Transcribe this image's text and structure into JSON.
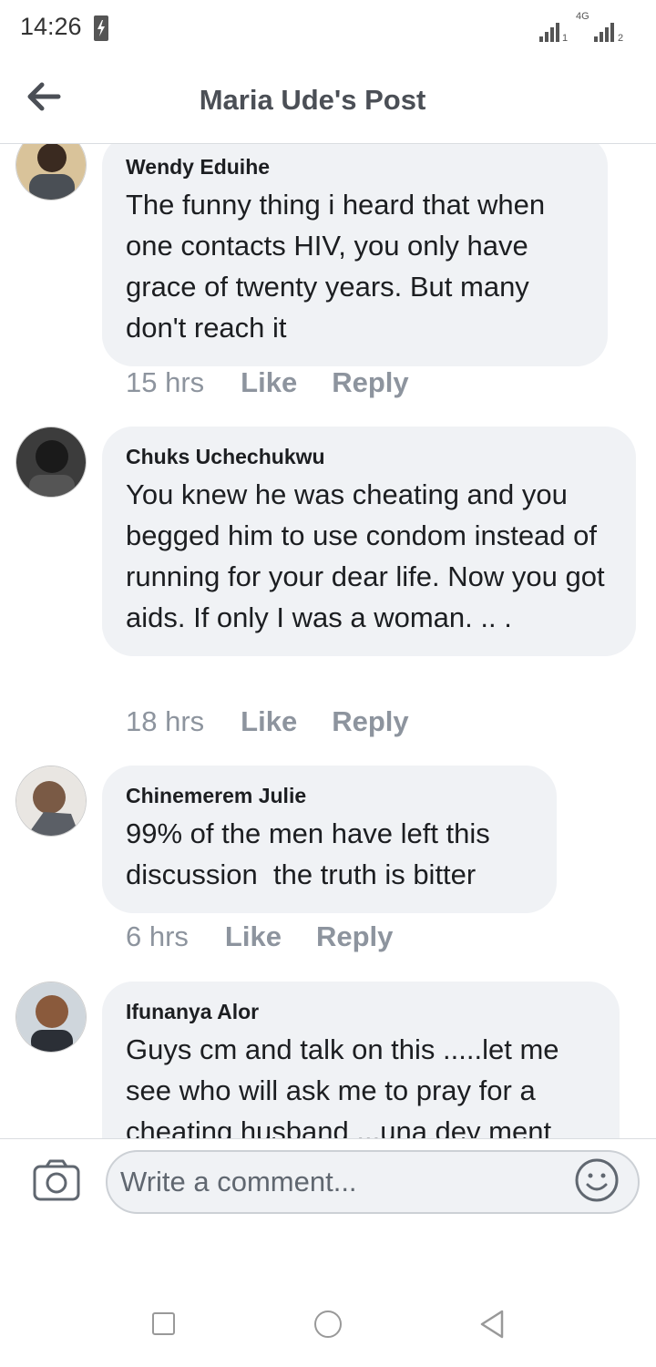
{
  "status_bar": {
    "time": "14:26",
    "network_label": "4G",
    "sim1": "1",
    "sim2": "2"
  },
  "header": {
    "title": "Maria Ude's Post"
  },
  "comments": [
    {
      "author": "Wendy Eduihe",
      "text": "The funny thing i heard that when one contacts HIV, you only have grace of twenty years. But many don't reach it",
      "time": "15 hrs",
      "like": "Like",
      "reply": "Reply"
    },
    {
      "author": "Chuks Uchechukwu",
      "text": "You knew he was cheating and you begged him to use condom instead of running for your dear life. Now you got aids. If only I was a woman. .. .",
      "time": "18 hrs",
      "like": "Like",
      "reply": "Reply"
    },
    {
      "author": "Chinemerem Julie",
      "text": "99% of the men have left this discussion  the truth is bitter",
      "time": "6 hrs",
      "like": "Like",
      "reply": "Reply"
    },
    {
      "author": "Ifunanya Alor",
      "text": "Guys cm and talk on this .....let me see who will ask me to pray for a cheating husband ...una dey ment",
      "time": "",
      "like": "",
      "reply": ""
    }
  ],
  "composer": {
    "placeholder": "Write a comment..."
  },
  "icons": {
    "back": "arrow-left-icon",
    "camera": "camera-icon",
    "emoji": "smiley-icon",
    "nav_recent": "square-icon",
    "nav_home": "circle-icon",
    "nav_back": "triangle-back-icon"
  },
  "colors": {
    "bubble": "#f0f2f5",
    "meta_text": "#8d949e",
    "title": "#4b4f56"
  }
}
